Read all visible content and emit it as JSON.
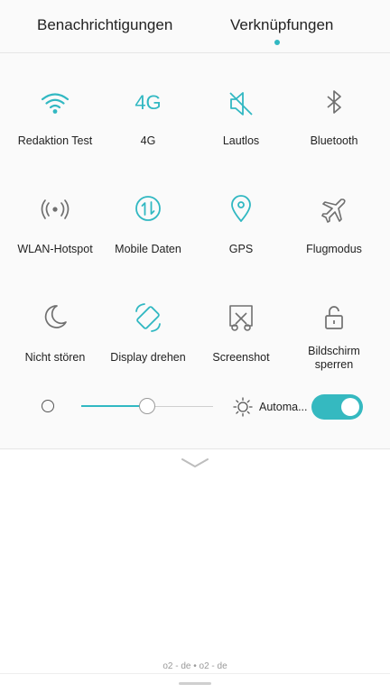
{
  "tabs": {
    "left": "Benachrichtigungen",
    "right": "Verknüpfungen",
    "active": "right"
  },
  "colors": {
    "accent": "#31b8c2",
    "icon_gray": "#707070"
  },
  "tiles": [
    {
      "label": "Redaktion Test",
      "icon": "wifi-icon",
      "active": true
    },
    {
      "label": "4G",
      "icon": "4g-icon",
      "active": true
    },
    {
      "label": "Lautlos",
      "icon": "silent-icon",
      "active": true
    },
    {
      "label": "Bluetooth",
      "icon": "bluetooth-icon",
      "active": false
    },
    {
      "label": "WLAN-Hotspot",
      "icon": "hotspot-icon",
      "active": false
    },
    {
      "label": "Mobile Daten",
      "icon": "mobile-data-icon",
      "active": true
    },
    {
      "label": "GPS",
      "icon": "gps-icon",
      "active": true
    },
    {
      "label": "Flugmodus",
      "icon": "airplane-icon",
      "active": false
    },
    {
      "label": "Nicht stören",
      "icon": "moon-icon",
      "active": false
    },
    {
      "label": "Display drehen",
      "icon": "rotate-icon",
      "active": true
    },
    {
      "label": "Screenshot",
      "icon": "screenshot-icon",
      "active": false
    },
    {
      "label": "Bildschirm sperren",
      "icon": "lock-icon",
      "active": false
    }
  ],
  "tile_labels_multiline": {
    "line1": "Bildschirm",
    "line2": "sperren"
  },
  "brightness": {
    "level_percent": 50,
    "auto_label": "Automa...",
    "auto_enabled": true
  },
  "carrier": "o2 - de • o2 - de"
}
